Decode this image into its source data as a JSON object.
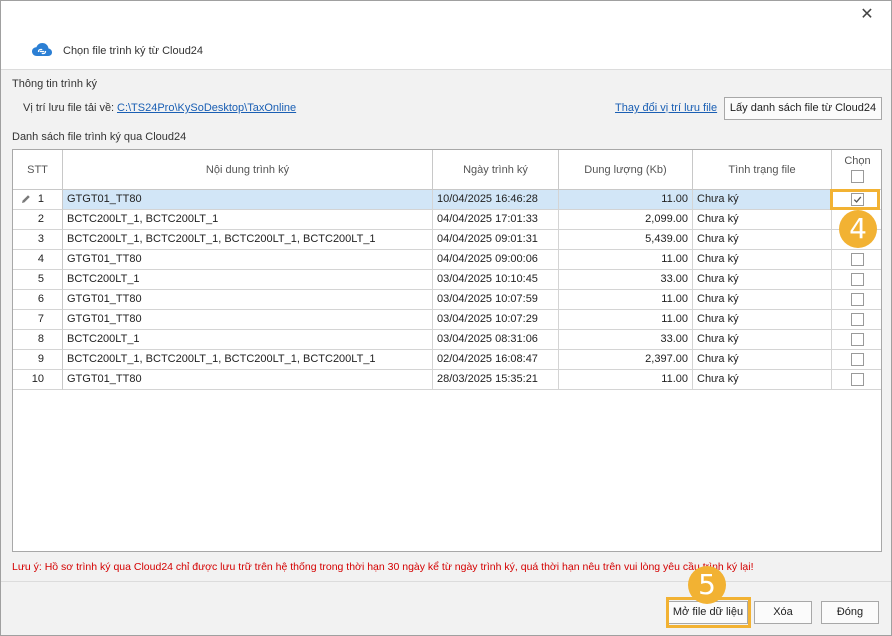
{
  "dialog": {
    "title": "Chọn file trình ký từ Cloud24",
    "close_glyph": "✕"
  },
  "info": {
    "section_label": "Thông tin trình ký",
    "path_label": "Vị trí lưu file tải về:",
    "path_value": "C:\\TS24Pro\\KySoDesktop\\TaxOnline",
    "change_link": "Thay đổi vị trí lưu file",
    "get_list_button": "Lấy danh sách file từ Cloud24"
  },
  "list": {
    "section_label": "Danh sách file trình ký qua Cloud24",
    "columns": {
      "stt": "STT",
      "content": "Nội dung trình ký",
      "date": "Ngày trình ký",
      "size": "Dung lượng (Kb)",
      "status": "Tình trạng file",
      "select": "Chọn"
    },
    "rows": [
      {
        "stt": "1",
        "content": "GTGT01_TT80",
        "date": "10/04/2025 16:46:28",
        "size": "11.00",
        "status": "Chưa ký",
        "checked": true
      },
      {
        "stt": "2",
        "content": "BCTC200LT_1, BCTC200LT_1",
        "date": "04/04/2025 17:01:33",
        "size": "2,099.00",
        "status": "Chưa ký",
        "checked": false
      },
      {
        "stt": "3",
        "content": "BCTC200LT_1, BCTC200LT_1, BCTC200LT_1, BCTC200LT_1",
        "date": "04/04/2025 09:01:31",
        "size": "5,439.00",
        "status": "Chưa ký",
        "checked": false
      },
      {
        "stt": "4",
        "content": "GTGT01_TT80",
        "date": "04/04/2025 09:00:06",
        "size": "11.00",
        "status": "Chưa ký",
        "checked": false
      },
      {
        "stt": "5",
        "content": "BCTC200LT_1",
        "date": "03/04/2025 10:10:45",
        "size": "33.00",
        "status": "Chưa ký",
        "checked": false
      },
      {
        "stt": "6",
        "content": "GTGT01_TT80",
        "date": "03/04/2025 10:07:59",
        "size": "11.00",
        "status": "Chưa ký",
        "checked": false
      },
      {
        "stt": "7",
        "content": "GTGT01_TT80",
        "date": "03/04/2025 10:07:29",
        "size": "11.00",
        "status": "Chưa ký",
        "checked": false
      },
      {
        "stt": "8",
        "content": "BCTC200LT_1",
        "date": "03/04/2025 08:31:06",
        "size": "33.00",
        "status": "Chưa ký",
        "checked": false
      },
      {
        "stt": "9",
        "content": "BCTC200LT_1, BCTC200LT_1, BCTC200LT_1, BCTC200LT_1",
        "date": "02/04/2025 16:08:47",
        "size": "2,397.00",
        "status": "Chưa ký",
        "checked": false
      },
      {
        "stt": "10",
        "content": "GTGT01_TT80",
        "date": "28/03/2025 15:35:21",
        "size": "11.00",
        "status": "Chưa ký",
        "checked": false
      }
    ]
  },
  "note": "Lưu ý: Hồ sơ trình ký qua Cloud24 chỉ được lưu trữ trên hệ thống trong thời hạn 30 ngày kể từ ngày trình ký, quá thời hạn nêu trên vui lòng yêu cầu trình ký lại!",
  "buttons": {
    "open": "Mở file dữ liệu",
    "delete": "Xóa",
    "close": "Đóng"
  },
  "annotations": {
    "step_select": "4",
    "step_open": "5",
    "accent_color": "#f2b233"
  },
  "colors": {
    "link": "#1a5fb4",
    "note": "#d40000",
    "selected_row": "#d2e6f7"
  }
}
